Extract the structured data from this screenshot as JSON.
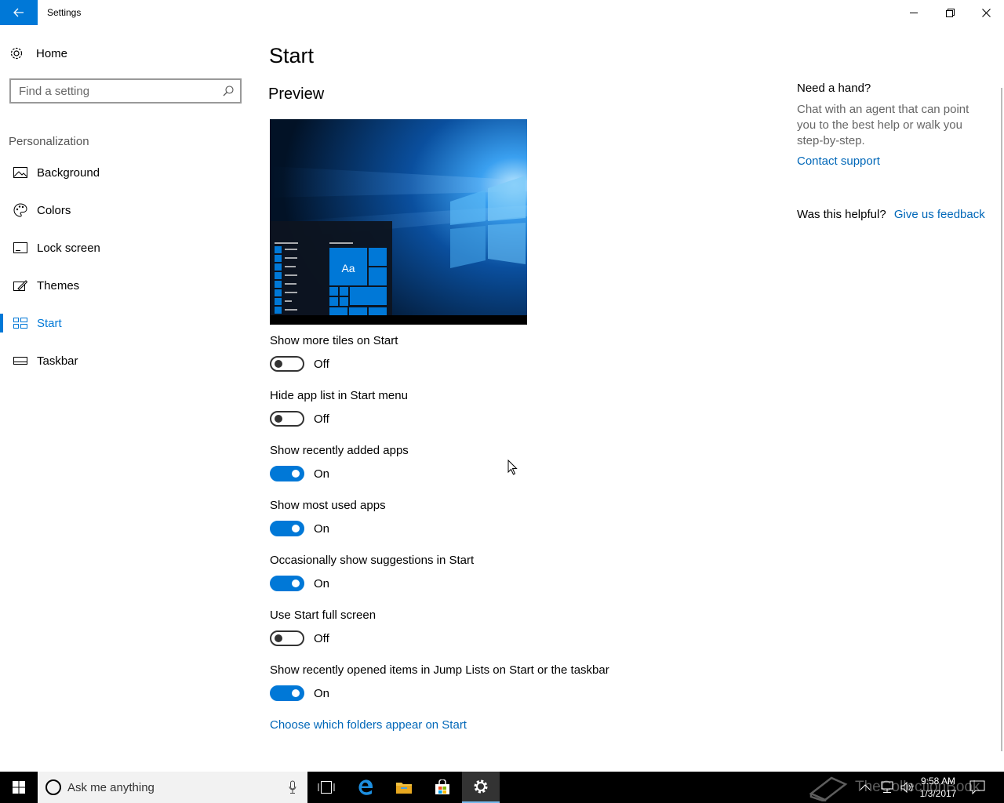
{
  "window": {
    "title": "Settings"
  },
  "sidebar": {
    "home_label": "Home",
    "search_placeholder": "Find a setting",
    "section_label": "Personalization",
    "items": [
      {
        "label": "Background",
        "icon": "picture-icon"
      },
      {
        "label": "Colors",
        "icon": "palette-icon"
      },
      {
        "label": "Lock screen",
        "icon": "lock-screen-icon"
      },
      {
        "label": "Themes",
        "icon": "themes-icon"
      },
      {
        "label": "Start",
        "icon": "start-menu-icon",
        "selected": true
      },
      {
        "label": "Taskbar",
        "icon": "taskbar-icon"
      }
    ]
  },
  "main": {
    "title": "Start",
    "preview_label": "Preview",
    "preview_tile_text": "Aa",
    "settings": [
      {
        "label": "Show more tiles on Start",
        "state": "Off"
      },
      {
        "label": "Hide app list in Start menu",
        "state": "Off"
      },
      {
        "label": "Show recently added apps",
        "state": "On"
      },
      {
        "label": "Show most used apps",
        "state": "On"
      },
      {
        "label": "Occasionally show suggestions in Start",
        "state": "On"
      },
      {
        "label": "Use Start full screen",
        "state": "Off"
      },
      {
        "label": "Show recently opened items in Jump Lists on Start or the taskbar",
        "state": "On"
      }
    ],
    "folders_link": "Choose which folders appear on Start"
  },
  "help": {
    "title": "Need a hand?",
    "text": "Chat with an agent that can point you to the best help or walk you step-by-step.",
    "contact_link": "Contact support",
    "helpful_label": "Was this helpful?",
    "feedback_link": "Give us feedback"
  },
  "taskbar": {
    "search_placeholder": "Ask me anything",
    "time": "9:58 AM",
    "date": "1/3/2017",
    "watermark": "TheCollectionBook"
  },
  "colors": {
    "accent": "#0078d7",
    "link": "#0067b8"
  }
}
